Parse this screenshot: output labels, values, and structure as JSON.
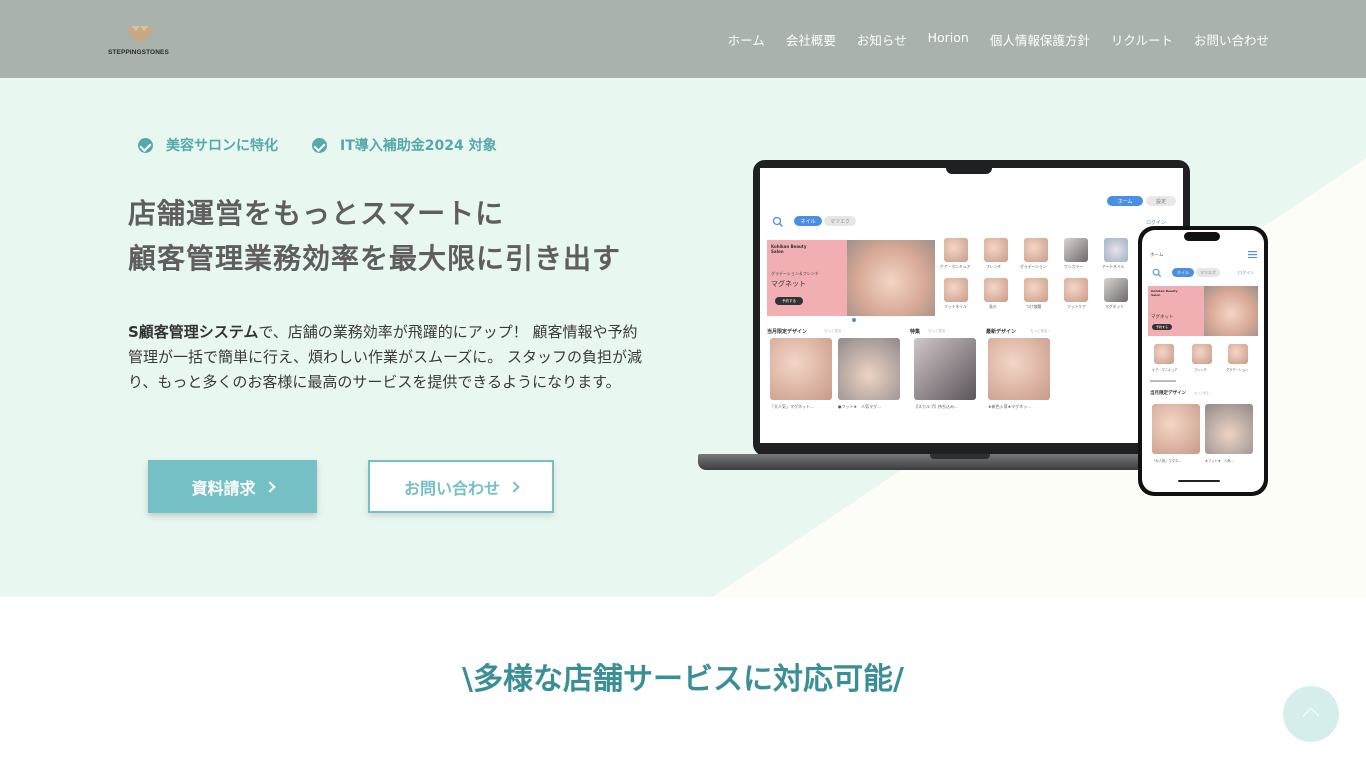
{
  "brand": {
    "logo_text": "STEPPINGSTONES"
  },
  "nav": {
    "items": [
      "ホーム",
      "会社概要",
      "お知らせ",
      "Horion",
      "個人情報保護方針",
      "リクルート",
      "お問い合わせ"
    ]
  },
  "hero": {
    "badges": [
      "美容サロンに特化",
      "IT導入補助金2024 対象"
    ],
    "headline_line1": "店舗運営をもっとスマートに",
    "headline_line2": "顧客管理業務効率を最大限に引き出す",
    "desc_bold": "S顧客管理システム",
    "desc_rest": "で、店舗の業務効率が飛躍的にアップ！ 顧客情報や予約管理が一括で簡単に行え、煩わしい作業がスムーズに。 スタッフの負担が減り、もっと多くのお客様に最高のサービスを提供できるようになります。",
    "btn_primary": "資料請求",
    "btn_secondary": "お問い合わせ"
  },
  "mockup": {
    "tab_home": "ホーム",
    "tab_settings": "設定",
    "tab_nail": "ネイル",
    "tab_eyelash": "マツエク",
    "login": "ログイン",
    "banner_salon": "Kohikan Beauty Salon",
    "banner_sub": "グラデーション＆フレンチ",
    "banner_main": "マグネット",
    "banner_btn": "予約する",
    "categories": [
      "ケア・マニキュア",
      "フレンチ",
      "グラデーション",
      "ワンカラー",
      "アートネイル",
      "フットネイル",
      "長爪",
      "つけ放題",
      "フットケア",
      "マグネット"
    ],
    "section_labels": [
      "当月限定デザイン",
      "特集",
      "最新デザイン"
    ],
    "more": "もっと見る ›",
    "captions": [
      "「大人気」マグネット...",
      "●フット★　人気マグ...",
      "【スカルプ】持ち込み...",
      "★新色入荷★マグネッ..."
    ],
    "phone_home": "ホーム",
    "phone_categories": [
      "ケア・マニキュア",
      "フレンチ",
      "グラデーション"
    ],
    "phone_section": "当月限定デザイン",
    "phone_captions": [
      "「大人気」マグネ...",
      "★フット★　人気..."
    ]
  },
  "section2": {
    "title": "\\多様な店舗サービスに対応可能/"
  },
  "colors": {
    "header_bg": "#a9b2ac",
    "hero_bg": "#e9f7f1",
    "accent": "#75c0c4",
    "title": "#3a8f96"
  }
}
